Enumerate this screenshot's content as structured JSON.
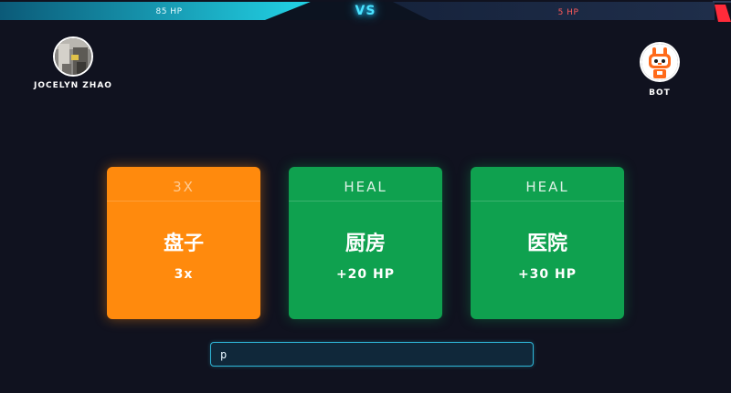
{
  "hud": {
    "left_hp": "85 HP",
    "right_hp": "5 HP",
    "vs": "VS",
    "left_hp_fraction": 0.85,
    "right_hp_fraction": 0.05,
    "left_color": "#1ec8e0",
    "right_color": "#ff2b3a"
  },
  "players": {
    "left": {
      "name": "JOCELYN ZHAO"
    },
    "right": {
      "name": "BOT"
    }
  },
  "cards": [
    {
      "type": "3X",
      "word": "盘子",
      "effect": "3x",
      "color": "#ff8a0d"
    },
    {
      "type": "HEAL",
      "word": "厨房",
      "effect": "+20 HP",
      "color": "#0fa14f"
    },
    {
      "type": "HEAL",
      "word": "医院",
      "effect": "+30 HP",
      "color": "#0fa14f"
    }
  ],
  "input": {
    "value": "p",
    "placeholder": ""
  }
}
